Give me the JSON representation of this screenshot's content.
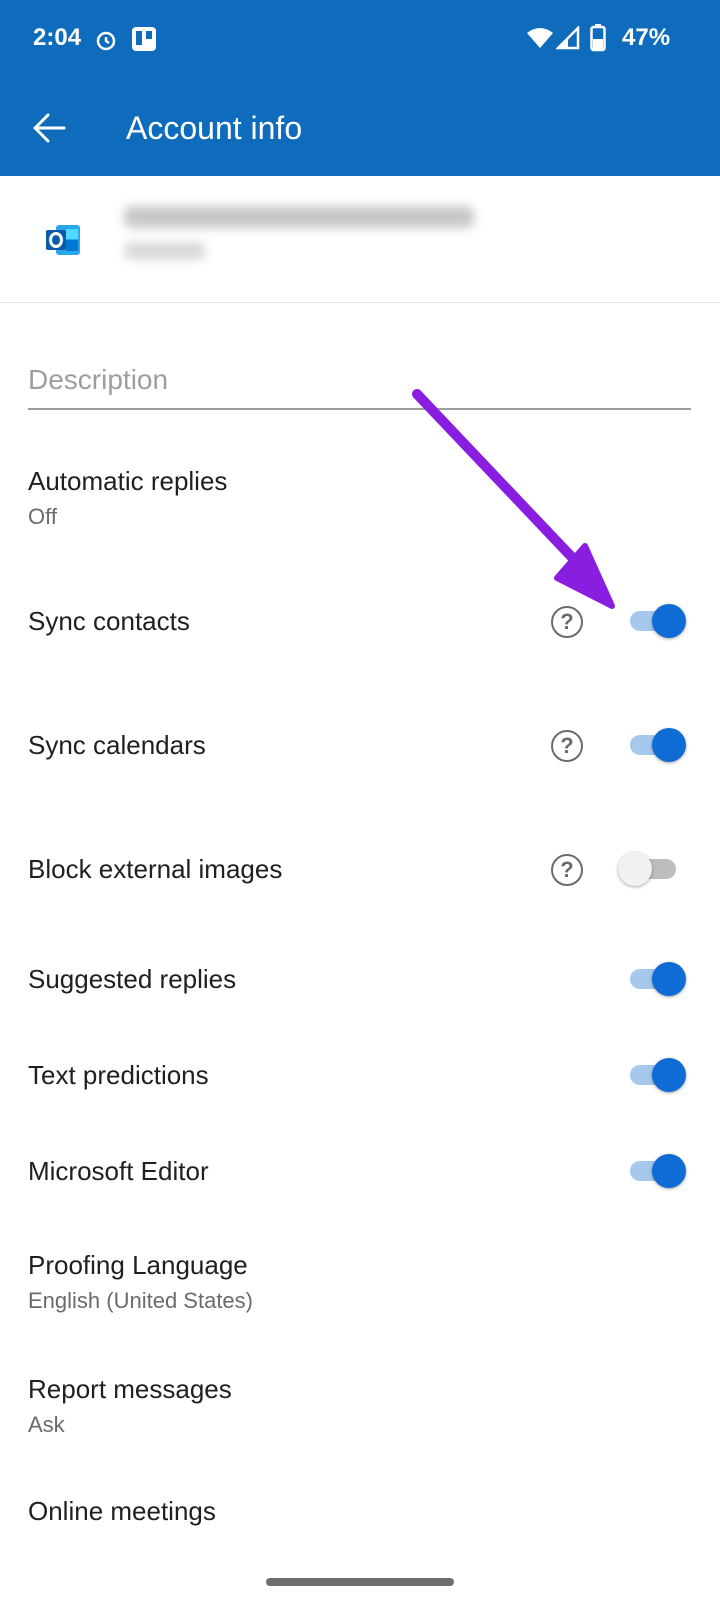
{
  "status_bar": {
    "time": "2:04",
    "battery": "47%",
    "icons": [
      "alarm-icon",
      "trello-icon",
      "wifi-icon",
      "cell-signal-icon",
      "battery-icon"
    ]
  },
  "header": {
    "title": "Account info",
    "back_icon": "arrow-left-icon"
  },
  "account": {
    "logo_icon": "outlook-logo-icon"
  },
  "description": {
    "placeholder": "Description",
    "value": ""
  },
  "settings": {
    "automatic_replies": {
      "label": "Automatic replies",
      "value": "Off"
    },
    "sync_contacts": {
      "label": "Sync contacts",
      "enabled": true
    },
    "sync_calendars": {
      "label": "Sync calendars",
      "enabled": true
    },
    "block_external_images": {
      "label": "Block external images",
      "enabled": false
    },
    "suggested_replies": {
      "label": "Suggested replies",
      "enabled": true
    },
    "text_predictions": {
      "label": "Text predictions",
      "enabled": true
    },
    "microsoft_editor": {
      "label": "Microsoft Editor",
      "enabled": true
    },
    "proofing_language": {
      "label": "Proofing Language",
      "value": "English (United States)"
    },
    "report_messages": {
      "label": "Report messages",
      "value": "Ask"
    },
    "online_meetings": {
      "label": "Online meetings"
    }
  },
  "help_symbol": "?",
  "colors": {
    "appbar": "#0f6cbd",
    "switch_on": "#0f6cd4",
    "switch_track_on": "#a5c8ec",
    "annotation_arrow": "#8a1ee0"
  }
}
